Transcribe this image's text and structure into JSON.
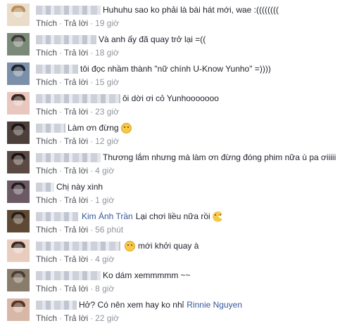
{
  "labels": {
    "like": "Thích",
    "reply": "Trả lời",
    "dot": "·"
  },
  "comments": [
    {
      "author_w": 92,
      "text": "Huhuhu sao ko phải là bài hát mới, wae :((((((((",
      "time": "19 giờ",
      "avatar_color": "#e9dcc8",
      "hair_color": "#b98e5a"
    },
    {
      "author_w": 86,
      "text": "Và anh ấy đã quay trở lại =((",
      "time": "18 giờ",
      "avatar_color": "#7b8a78",
      "hair_color": "#3d3a36"
    },
    {
      "author_w": 60,
      "text": "tôi đọc nhầm thành \"nữ chính U-Know Yunho\" =))))",
      "time": "15 giờ",
      "avatar_color": "#7c8fa8",
      "hair_color": "#1d2430"
    },
    {
      "author_w": 120,
      "text": "ôi dời ơi cỏ Yunhooooooo",
      "time": "23 giờ",
      "avatar_color": "#e9c6be",
      "hair_color": "#3a2620"
    },
    {
      "author_w": 42,
      "text": "Làm ơn đừng",
      "emoji": "sad",
      "time": "12 giờ",
      "avatar_color": "#4d3f3a",
      "hair_color": "#1b1412"
    },
    {
      "author_w": 92,
      "text": "Thương lắm nhưng mà làm ơn đừng đóng phim nữa ù pa ơiiiii",
      "time": "4 giờ",
      "avatar_color": "#5b4a43",
      "hair_color": "#1a1210"
    },
    {
      "author_w": 26,
      "text": "Chị này xinh",
      "time": "1 giờ",
      "avatar_color": "#6b5a63",
      "hair_color": "#251a1e"
    },
    {
      "author_w": 60,
      "mention": "Kim Ánh Trần",
      "text": "Lại chơi liều nữa rồi",
      "emoji": "pacman",
      "time": "56 phút",
      "avatar_color": "#5e4a34",
      "hair_color": "#2b1d12"
    },
    {
      "author_w": 120,
      "emoji_first": "smile",
      "text": "mới khởi quay à",
      "time": "4 giờ",
      "avatar_color": "#e8cdbf",
      "hair_color": "#3a2a22"
    },
    {
      "author_w": 92,
      "text": "Ko dám xemmmmm ~~",
      "time": "8 giờ",
      "avatar_color": "#8a7c6a",
      "hair_color": "#4a3d31"
    },
    {
      "author_w": 58,
      "text": "Hở? Có nên xem hay ko nhỉ",
      "mention_after": "Rinnie Nguyen",
      "time": "22 giờ",
      "avatar_color": "#d9b7a7",
      "hair_color": "#5a3526"
    }
  ]
}
